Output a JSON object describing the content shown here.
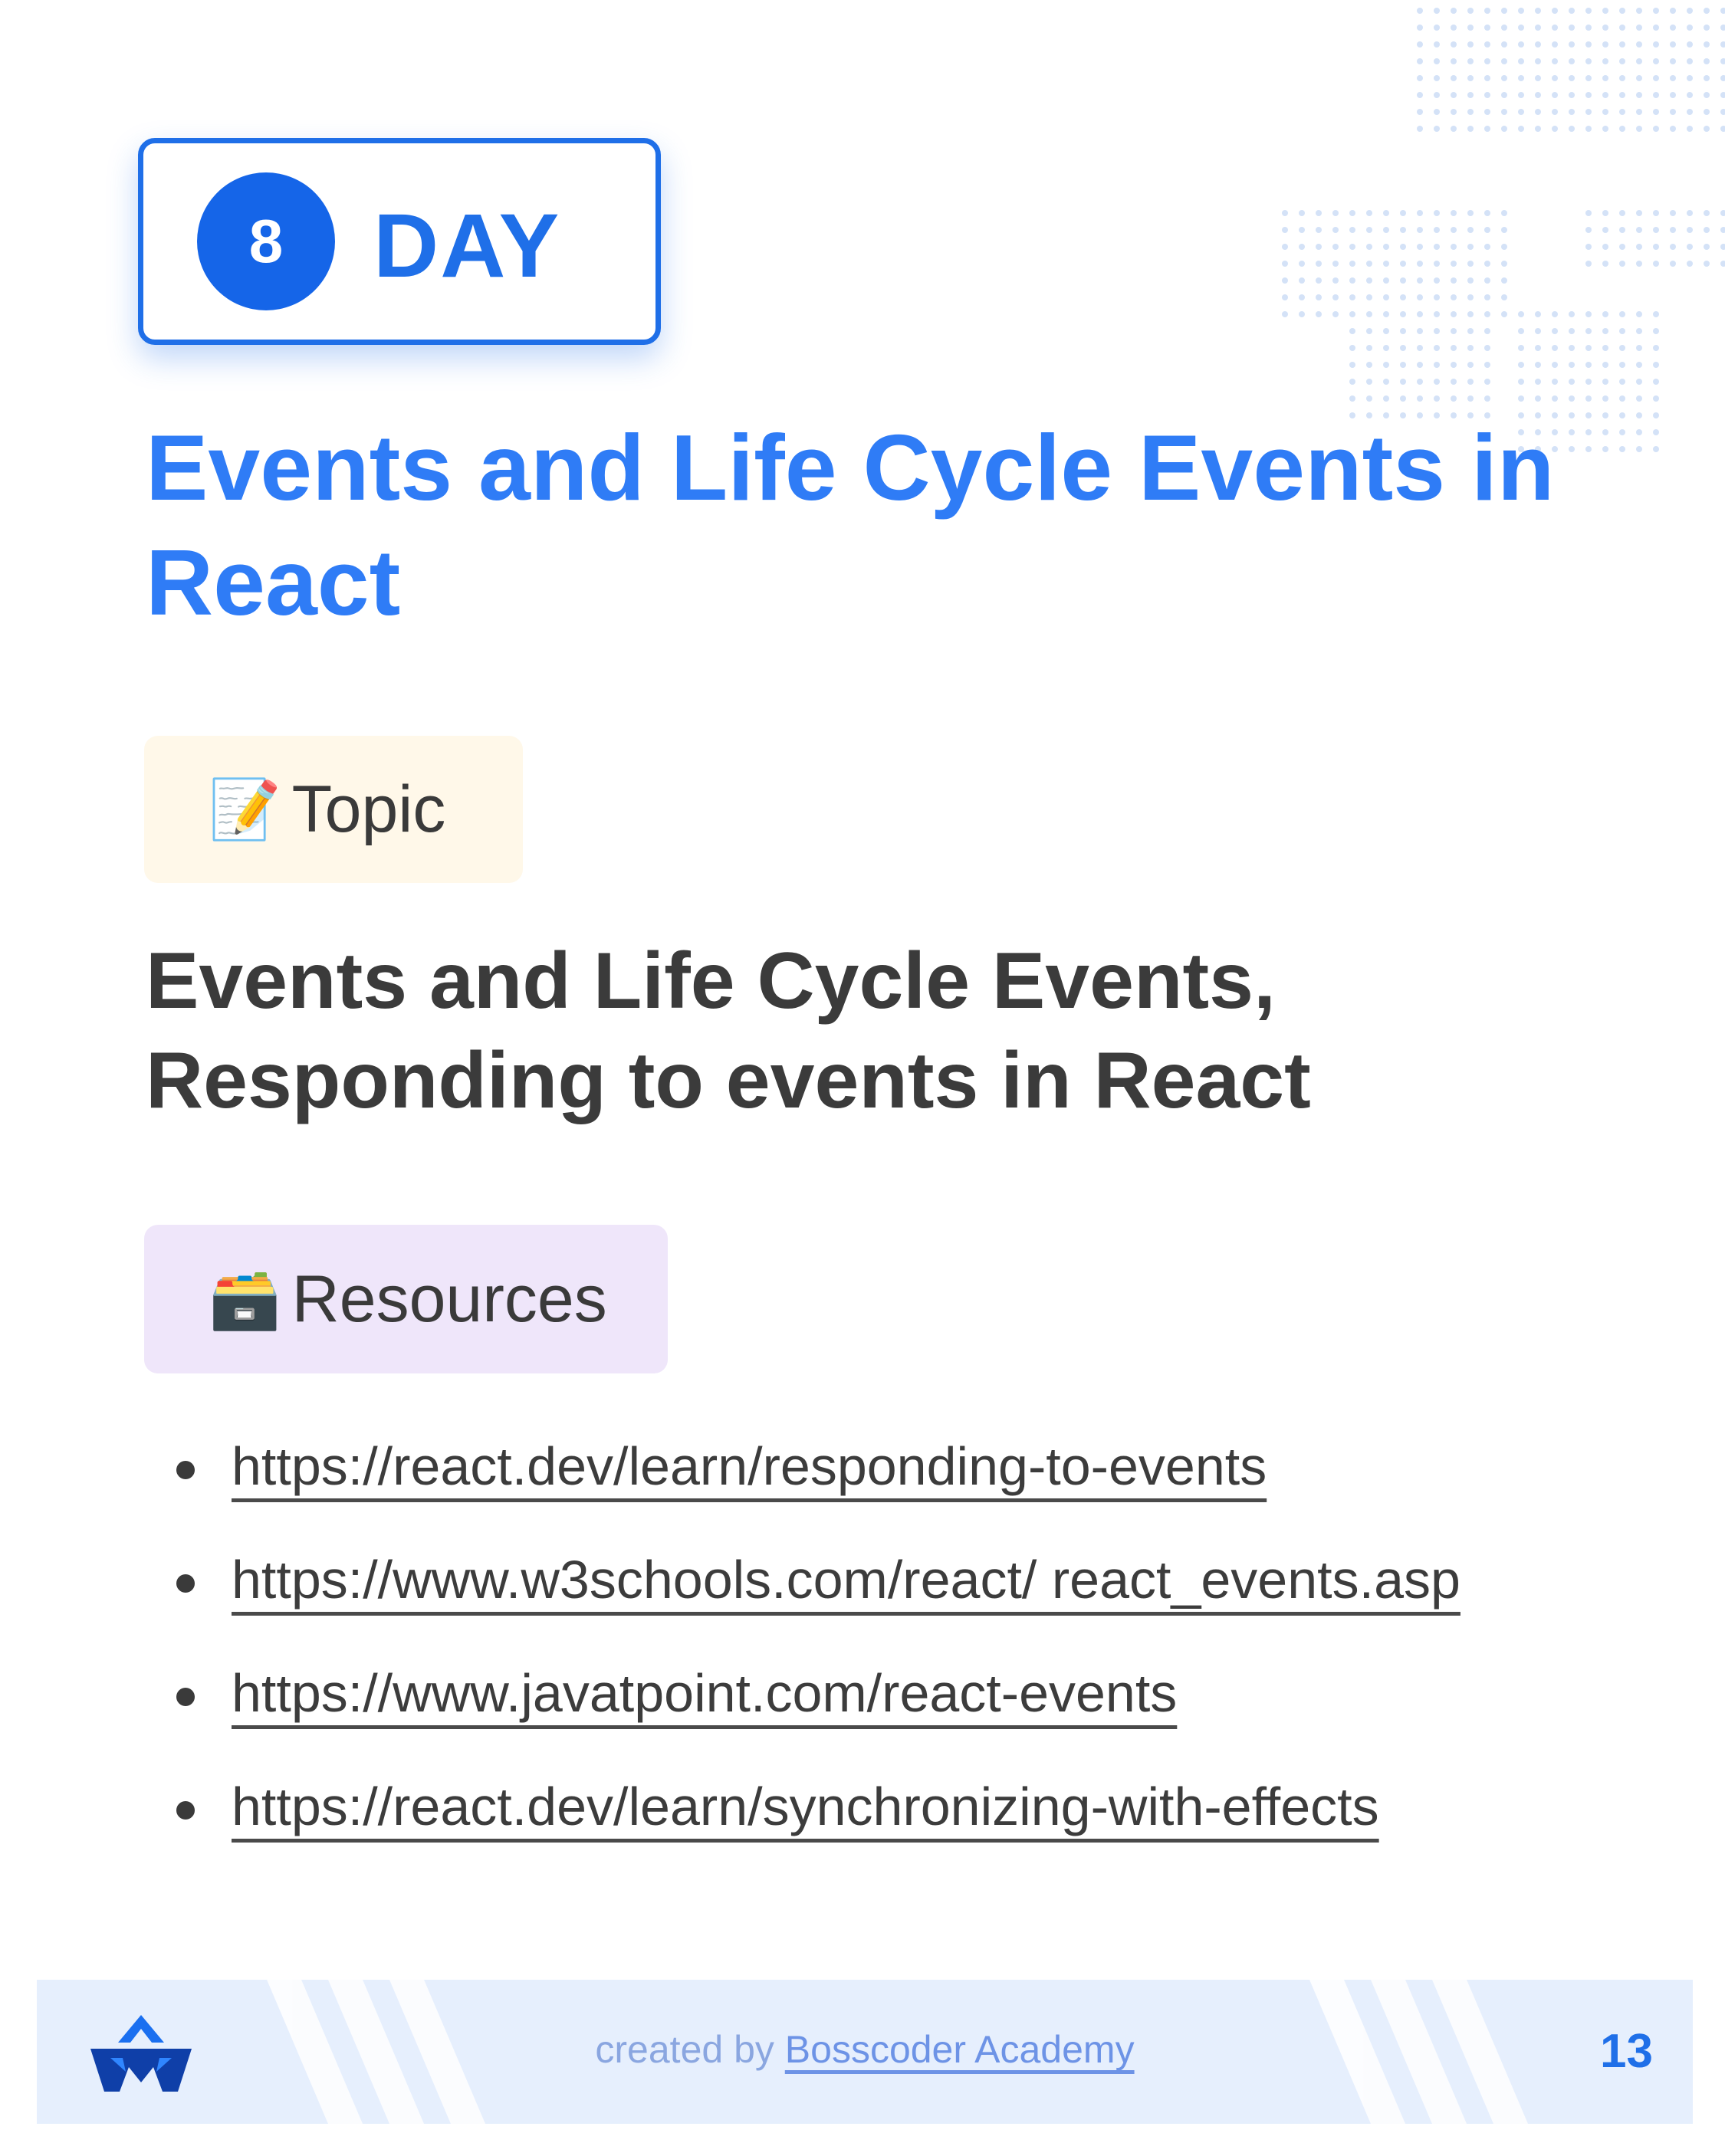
{
  "day_badge": {
    "number": "8",
    "label": "DAY"
  },
  "title": "Events and Life Cycle Events in React",
  "topic_pill": {
    "emoji": "📝",
    "label": "Topic"
  },
  "topic_text": "Events and Life Cycle Events, Responding to events in React",
  "resources_pill": {
    "emoji": "🗃️",
    "label": "Resources"
  },
  "links": [
    "https://react.dev/learn/responding-to-events",
    "https://www.w3schools.com/react/ react_events.asp",
    "https://www.javatpoint.com/react-events",
    "https://react.dev/learn/synchronizing-with-effects"
  ],
  "footer": {
    "credit_prefix": "created by ",
    "credit_brand": "Bosscoder Academy",
    "page_number": "13",
    "logo_icon": "bosscoder-logo-icon"
  },
  "colors": {
    "accent": "#1f6fe8",
    "title": "#2f7cf6",
    "topic_bg": "#fff8e9",
    "resources_bg": "#efe6fa",
    "footer_bg": "#e6effd"
  }
}
